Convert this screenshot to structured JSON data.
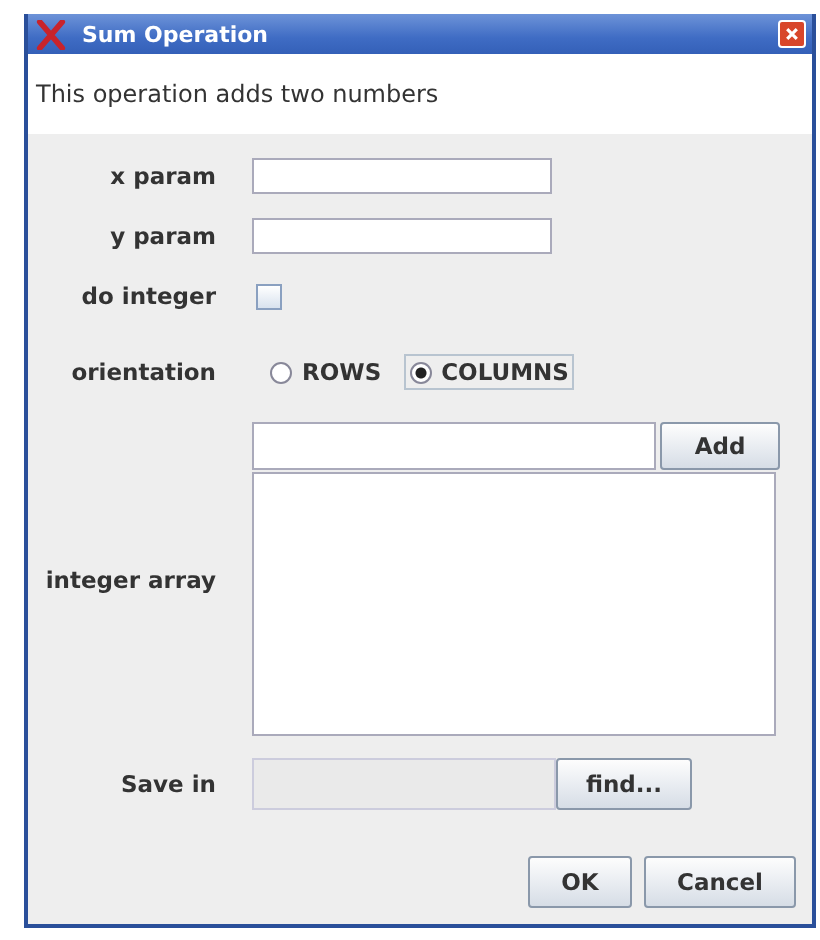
{
  "window": {
    "title": "Sum Operation"
  },
  "description": "This operation adds two numbers",
  "fields": [
    {
      "label": "x param"
    },
    {
      "label": "y param"
    }
  ],
  "do_integer": {
    "label": "do integer",
    "checked": false
  },
  "orientation": {
    "label": "orientation",
    "options": [
      {
        "label": "ROWS",
        "selected": false
      },
      {
        "label": "COLUMNS",
        "selected": true
      }
    ]
  },
  "integer_array": {
    "label": "integer array",
    "add_button": "Add"
  },
  "save_in": {
    "label": "Save in",
    "button": "find..."
  },
  "buttons": [
    "OK",
    "Cancel"
  ]
}
